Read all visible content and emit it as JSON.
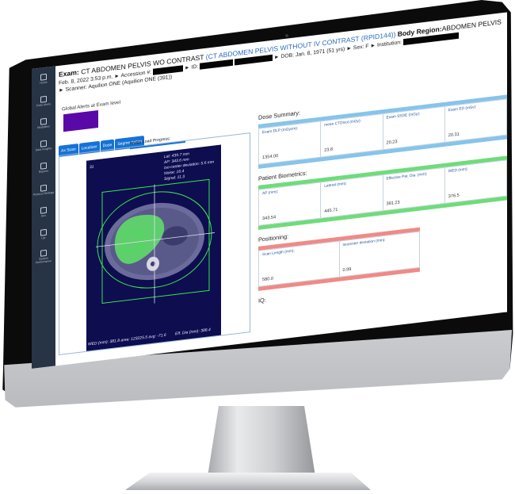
{
  "colors": {
    "accent": "#1572d6",
    "alert": "#5a08a8",
    "dose": "#87c4ea",
    "biometrics": "#6fdc7a",
    "positioning": "#f08a86",
    "sidebar": "#273445"
  },
  "sidebar": {
    "items": [
      {
        "icon": "home-icon",
        "label": "Home"
      },
      {
        "icon": "alert-icon",
        "label": "Dose Alerts"
      },
      {
        "icon": "grid-icon",
        "label": "Modalities"
      },
      {
        "icon": "chart-icon",
        "label": "Data Insights"
      },
      {
        "icon": "report-icon",
        "label": "Reports"
      },
      {
        "icon": "settings-icon",
        "label": "Protocol Settings"
      },
      {
        "icon": "device-icon",
        "label": "Dev"
      },
      {
        "icon": "user-icon",
        "label": "Usr"
      },
      {
        "icon": "performance-icon",
        "label": "System Performance"
      }
    ]
  },
  "header": {
    "exam_label": "Exam:",
    "exam_name": "CT ABDOMEN PELVIS WO CONTRAST",
    "exam_link": "(CT ABDOMEN PELVIS WITHOUT IV CONTRAST (RPID144))",
    "region_label": "Body Region:",
    "region_value": "ABDOMEN PELVIS",
    "date": "Feb. 8, 2022 3:53 p.m.",
    "accession_label": "► Accession #:",
    "id_label": "► ID:",
    "dob": "► DOB: Jan. 8, 1971 (51 yrs)",
    "sex": "► Sex: F",
    "institution_label": "► Institution:",
    "scanner": "► Scanner: Aquilion ONE (Aquilion ONE (391))"
  },
  "alerts": {
    "title": "Global Alerts at Exam level"
  },
  "tabs": [
    "Ax Scan",
    "Localizer",
    "Dose",
    "Segmentation"
  ],
  "image_panel": {
    "load_label": "Image Load Progress:",
    "slice": "31",
    "lat": "Lat: 439.7 mm",
    "ap": "AP: 343.6 mm",
    "iso": "Iso-center deviation: 5.6 mm",
    "noise": "Noise: 16.4",
    "signal": "Signal: 11.3",
    "footer_left": "WED (mm): 381.8 area: 123225.5 avg: -71.6",
    "footer_right": "Eff. Dia (mm): 388.4"
  },
  "dose": {
    "title": "Dose Summary:",
    "cards": [
      {
        "label": "Exam DLP (mGycm):",
        "value": "1354.00"
      },
      {
        "label": "mean CTDIvol (mGy):",
        "value": "23.6"
      },
      {
        "label": "Exam SSDE (mGy):",
        "value": "20.23"
      },
      {
        "label": "Exam ED (mSv):",
        "value": "20.31"
      }
    ]
  },
  "biometrics": {
    "title": "Patient Biometrics:",
    "cards": [
      {
        "label": "AP (mm):",
        "value": "343.54"
      },
      {
        "label": "Lateral (mm):",
        "value": "445.71"
      },
      {
        "label": "Effective Pat. Dia. (mm):",
        "value": "391.23"
      },
      {
        "label": "WED (mm):",
        "value": "376.5"
      }
    ]
  },
  "positioning": {
    "title": "Positioning:",
    "cards": [
      {
        "label": "Scan Length (mm):",
        "value": "580.0"
      },
      {
        "label": "Isocenter deviation (mm):",
        "value": "0.99"
      }
    ]
  },
  "iq": {
    "title": "IQ:"
  }
}
